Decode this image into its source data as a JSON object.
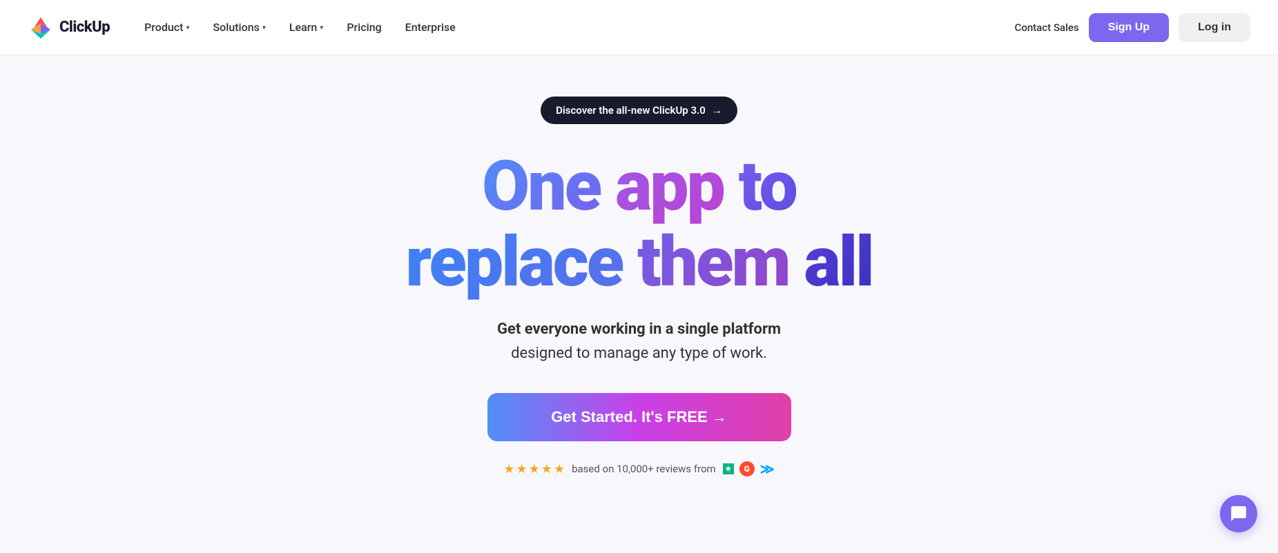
{
  "navbar": {
    "logo_text": "ClickUp",
    "nav_items": [
      {
        "label": "Product",
        "has_dropdown": true
      },
      {
        "label": "Solutions",
        "has_dropdown": true
      },
      {
        "label": "Learn",
        "has_dropdown": true
      },
      {
        "label": "Pricing",
        "has_dropdown": false
      },
      {
        "label": "Enterprise",
        "has_dropdown": false
      }
    ],
    "contact_sales_label": "Contact Sales",
    "signup_label": "Sign Up",
    "login_label": "Log in"
  },
  "hero": {
    "announcement_text": "Discover the all-new ClickUp 3.0",
    "headline_line1_word1": "One",
    "headline_line1_word2": "app",
    "headline_line1_word3": "to",
    "headline_line2_word1": "replace",
    "headline_line2_word2": "them",
    "headline_line2_word3": "all",
    "subheadline_bold": "Get everyone working in a single platform",
    "subheadline_normal": "designed to manage any type of work.",
    "cta_button": "Get Started. It's FREE →",
    "reviews_text": "based on 10,000+ reviews from",
    "stars_count": 5,
    "accent_color": "#7b68ee",
    "cta_gradient_start": "#4f90f8",
    "cta_gradient_mid": "#c940e8",
    "cta_gradient_end": "#e040a8"
  },
  "chat": {
    "icon_label": "chat-icon"
  }
}
